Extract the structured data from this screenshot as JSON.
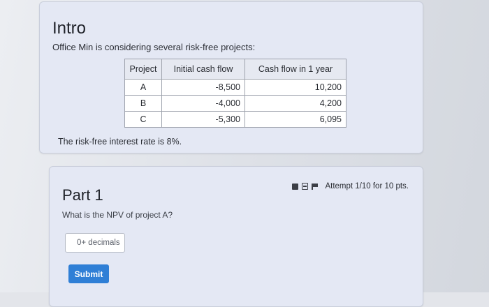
{
  "intro": {
    "title": "Intro",
    "description": "Office Min is considering several risk-free projects:",
    "table": {
      "headers": [
        "Project",
        "Initial cash flow",
        "Cash flow in 1 year"
      ],
      "rows": [
        [
          "A",
          "-8,500",
          "10,200"
        ],
        [
          "B",
          "-4,000",
          "4,200"
        ],
        [
          "C",
          "-5,300",
          "6,095"
        ]
      ]
    },
    "rate_text": "The risk-free interest rate is 8%."
  },
  "part1": {
    "title": "Part 1",
    "question": "What is the NPV of project A?",
    "status_icons": [
      "square-icon",
      "calculator-icon",
      "flag-icon"
    ],
    "attempt": "Attempt 1/10 for 10 pts.",
    "input_placeholder": "0+ decimals",
    "input_prefix": "+",
    "submit_label": "Submit",
    "submit_color": "#2f7fd6"
  }
}
